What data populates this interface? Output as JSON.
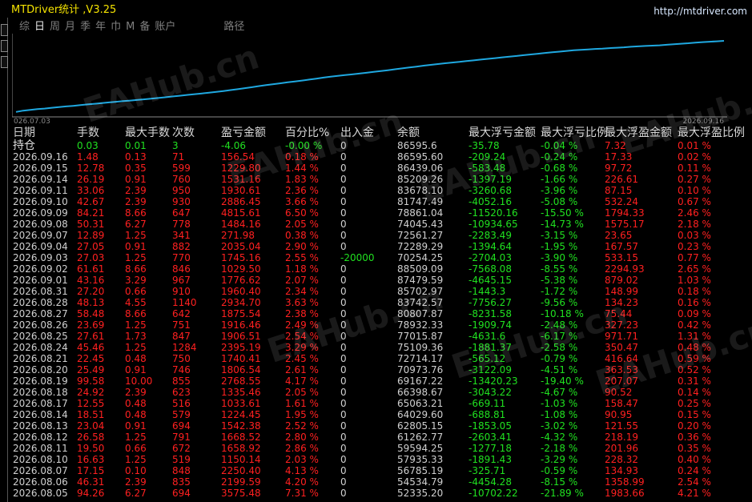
{
  "app": {
    "title": "MTDriver统计 ,V3.25",
    "url": "http://mtdriver.com"
  },
  "tabs": [
    "综",
    "日",
    "周",
    "月",
    "季",
    "年",
    "巾",
    "M",
    "备",
    "账户",
    "路径"
  ],
  "active_tab": "日",
  "watermark": "EAHub.cn",
  "colors": {
    "line": "#1fa8e0",
    "loss": "#ff2020",
    "gain": "#20e020",
    "text": "#d0d0d0",
    "title": "#f5e300"
  },
  "chart_data": {
    "type": "line",
    "x_start_label": "026.07.03",
    "x_end_label": "2026.09.16",
    "values": [
      6.0,
      7.5,
      8.5,
      9.3,
      10.0,
      11.0,
      11.8,
      12.6,
      13.3,
      14.1,
      15.0,
      15.8,
      16.6,
      17.4,
      18.2,
      18.9,
      19.6,
      20.4,
      21.2,
      22.0,
      22.8,
      23.7,
      24.6,
      25.5,
      26.4,
      27.3,
      28.2,
      29.1,
      30.1,
      31.1,
      32.2,
      33.3,
      34.5,
      35.7,
      37.0,
      38.2,
      39.3,
      40.4,
      41.5,
      42.6,
      43.7,
      44.8,
      46.0,
      47.2,
      48.3,
      49.2,
      50.2,
      51.1,
      52.0,
      53.0,
      54.0,
      55.0,
      56.1,
      57.2,
      58.3,
      59.4,
      60.4,
      61.5,
      62.5,
      63.5,
      64.4,
      65.3,
      66.1,
      67.0,
      67.9,
      68.8,
      69.7,
      70.6,
      71.5,
      72.4,
      73.2,
      74.1,
      75.0,
      75.9,
      76.8,
      77.6,
      78.4,
      79.2,
      80.0,
      80.6,
      81.1,
      81.6,
      82.0,
      82.6,
      83.1,
      83.6,
      84.2,
      84.7,
      85.2,
      85.6,
      86.0,
      86.6,
      87.2,
      87.9,
      88.5,
      89.2,
      89.8,
      90.3,
      90.8,
      91.3
    ],
    "ylim": [
      0,
      100
    ]
  },
  "table": {
    "headers": [
      "日期",
      "手数",
      "最大手数",
      "次数",
      "盈亏金额",
      "百分比%",
      "出入金",
      "余额",
      "最大浮亏金额",
      "最大浮亏比例",
      "最大浮盈金额",
      "最大浮盈比例"
    ],
    "hold": [
      "持仓",
      "0.03",
      "0.01",
      "3",
      "-4.06",
      "-0.00 %",
      "0",
      "86595.6",
      "-35.78",
      "-0.04 %",
      "7.32",
      "0.01 %"
    ],
    "rows": [
      [
        "2026.09.16",
        "1.48",
        "0.13",
        "71",
        "156.54",
        "0.18 %",
        "0",
        "86595.60",
        "-209.24",
        "-0.24 %",
        "17.33",
        "0.02 %"
      ],
      [
        "2026.09.15",
        "12.78",
        "0.35",
        "599",
        "1229.80",
        "1.44 %",
        "0",
        "86439.06",
        "-583.48",
        "-0.68 %",
        "97.72",
        "0.11 %"
      ],
      [
        "2026.09.14",
        "26.19",
        "0.91",
        "760",
        "1531.16",
        "1.83 %",
        "0",
        "85209.26",
        "-1397.19",
        "-1.66 %",
        "226.61",
        "0.27 %"
      ],
      [
        "2026.09.11",
        "33.06",
        "2.39",
        "950",
        "1930.61",
        "2.36 %",
        "0",
        "83678.10",
        "-3260.68",
        "-3.96 %",
        "87.15",
        "0.10 %"
      ],
      [
        "2026.09.10",
        "42.67",
        "2.39",
        "930",
        "2886.45",
        "3.66 %",
        "0",
        "81747.49",
        "-4052.16",
        "-5.08 %",
        "532.24",
        "0.67 %"
      ],
      [
        "2026.09.09",
        "84.21",
        "8.66",
        "647",
        "4815.61",
        "6.50 %",
        "0",
        "78861.04",
        "-11520.16",
        "-15.50 %",
        "1794.33",
        "2.46 %"
      ],
      [
        "2026.09.08",
        "50.31",
        "6.27",
        "778",
        "1484.16",
        "2.05 %",
        "0",
        "74045.43",
        "-10934.65",
        "-14.73 %",
        "1575.17",
        "2.18 %"
      ],
      [
        "2026.09.07",
        "12.89",
        "1.25",
        "341",
        "271.98",
        "0.38 %",
        "0",
        "72561.27",
        "-2283.49",
        "-3.15 %",
        "23.65",
        "0.03 %"
      ],
      [
        "2026.09.04",
        "27.05",
        "0.91",
        "882",
        "2035.04",
        "2.90 %",
        "0",
        "72289.29",
        "-1394.64",
        "-1.95 %",
        "167.57",
        "0.23 %"
      ],
      [
        "2026.09.03",
        "27.03",
        "1.25",
        "770",
        "1745.16",
        "2.55 %",
        "-20000",
        "70254.25",
        "-2704.03",
        "-3.90 %",
        "533.15",
        "0.77 %"
      ],
      [
        "2026.09.02",
        "61.61",
        "8.66",
        "846",
        "1029.50",
        "1.18 %",
        "0",
        "88509.09",
        "-7568.08",
        "-8.55 %",
        "2294.93",
        "2.65 %"
      ],
      [
        "2026.09.01",
        "43.16",
        "3.29",
        "967",
        "1776.62",
        "2.07 %",
        "0",
        "87479.59",
        "-4645.15",
        "-5.38 %",
        "879.02",
        "1.03 %"
      ],
      [
        "2026.08.31",
        "27.20",
        "0.66",
        "910",
        "1960.40",
        "2.34 %",
        "0",
        "85702.97",
        "-1443.3",
        "-1.72 %",
        "148.99",
        "0.18 %"
      ],
      [
        "2026.08.28",
        "48.13",
        "4.55",
        "1140",
        "2934.70",
        "3.63 %",
        "0",
        "83742.57",
        "-7756.27",
        "-9.56 %",
        "134.23",
        "0.16 %"
      ],
      [
        "2026.08.27",
        "58.48",
        "8.66",
        "642",
        "1875.54",
        "2.38 %",
        "0",
        "80807.87",
        "-8231.58",
        "-10.18 %",
        "75.44",
        "0.09 %"
      ],
      [
        "2026.08.26",
        "23.69",
        "1.25",
        "751",
        "1916.46",
        "2.49 %",
        "0",
        "78932.33",
        "-1909.74",
        "-2.48 %",
        "327.23",
        "0.42 %"
      ],
      [
        "2026.08.25",
        "27.61",
        "1.73",
        "847",
        "1906.51",
        "2.54 %",
        "0",
        "77015.87",
        "-4631.6",
        "-6.17 %",
        "971.71",
        "1.31 %"
      ],
      [
        "2026.08.24",
        "45.46",
        "1.25",
        "1284",
        "2395.19",
        "3.29 %",
        "0",
        "75109.36",
        "-1881.37",
        "-2.58 %",
        "350.47",
        "0.48 %"
      ],
      [
        "2026.08.21",
        "22.45",
        "0.48",
        "750",
        "1740.41",
        "2.45 %",
        "0",
        "72714.17",
        "-565.12",
        "-0.79 %",
        "416.64",
        "0.59 %"
      ],
      [
        "2026.08.20",
        "25.49",
        "0.91",
        "746",
        "1806.54",
        "2.61 %",
        "0",
        "70973.76",
        "-3122.09",
        "-4.51 %",
        "363.53",
        "0.52 %"
      ],
      [
        "2026.08.19",
        "99.58",
        "10.00",
        "855",
        "2768.55",
        "4.17 %",
        "0",
        "69167.22",
        "-13420.23",
        "-19.40 %",
        "207.07",
        "0.31 %"
      ],
      [
        "2026.08.18",
        "24.92",
        "2.39",
        "623",
        "1335.46",
        "2.05 %",
        "0",
        "66398.67",
        "-3043.22",
        "-4.67 %",
        "90.52",
        "0.14 %"
      ],
      [
        "2026.08.17",
        "12.55",
        "0.48",
        "516",
        "1033.61",
        "1.61 %",
        "0",
        "65063.21",
        "-669.11",
        "-1.03 %",
        "158.47",
        "0.25 %"
      ],
      [
        "2026.08.14",
        "18.51",
        "0.48",
        "579",
        "1224.45",
        "1.95 %",
        "0",
        "64029.60",
        "-688.81",
        "-1.08 %",
        "90.95",
        "0.15 %"
      ],
      [
        "2026.08.13",
        "23.04",
        "0.91",
        "694",
        "1542.38",
        "2.52 %",
        "0",
        "62805.15",
        "-1853.05",
        "-3.02 %",
        "121.55",
        "0.20 %"
      ],
      [
        "2026.08.12",
        "26.58",
        "1.25",
        "791",
        "1668.52",
        "2.80 %",
        "0",
        "61262.77",
        "-2603.41",
        "-4.32 %",
        "218.19",
        "0.36 %"
      ],
      [
        "2026.08.11",
        "19.50",
        "0.66",
        "672",
        "1658.92",
        "2.86 %",
        "0",
        "59594.25",
        "-1277.18",
        "-2.18 %",
        "201.96",
        "0.35 %"
      ],
      [
        "2026.08.10",
        "16.63",
        "1.25",
        "519",
        "1150.14",
        "2.03 %",
        "0",
        "57935.33",
        "-1891.43",
        "-3.29 %",
        "228.32",
        "0.40 %"
      ],
      [
        "2026.08.07",
        "17.15",
        "0.10",
        "848",
        "2250.40",
        "4.13 %",
        "0",
        "56785.19",
        "-325.71",
        "-0.59 %",
        "134.93",
        "0.24 %"
      ],
      [
        "2026.08.06",
        "46.31",
        "2.39",
        "835",
        "2199.59",
        "4.20 %",
        "0",
        "54534.79",
        "-4454.28",
        "-8.15 %",
        "1358.99",
        "2.54 %"
      ],
      [
        "2026.08.05",
        "94.26",
        "6.27",
        "694",
        "3575.48",
        "7.31 %",
        "0",
        "52335.20",
        "-10702.22",
        "-21.89 %",
        "1983.66",
        "4.21 %"
      ]
    ]
  }
}
